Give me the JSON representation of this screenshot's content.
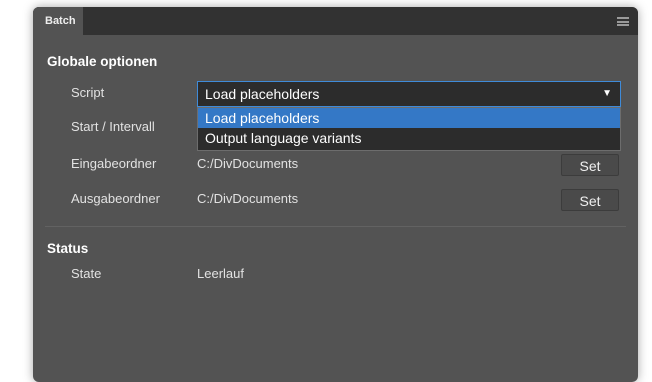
{
  "tab": {
    "title": "Batch"
  },
  "global_section": {
    "title": "Globale optionen",
    "script": {
      "label": "Script",
      "selected": "Load placeholders",
      "options": [
        "Load placeholders",
        "Output language variants"
      ]
    },
    "start_interval": {
      "label": "Start / Intervall"
    },
    "input_folder": {
      "label": "Eingabeordner",
      "value": "C:/DivDocuments",
      "button": "Set"
    },
    "output_folder": {
      "label": "Ausgabeordner",
      "value": "C:/DivDocuments",
      "button": "Set"
    }
  },
  "status_section": {
    "title": "Status",
    "state": {
      "label": "State",
      "value": "Leerlauf"
    }
  },
  "colors": {
    "panel": "#535353",
    "tabbar": "#323232",
    "accent": "#3478c6",
    "focus_border": "#3f8bd9"
  },
  "icons": {
    "panel_menu": "hamburger-menu-icon",
    "dropdown": "triangle-down-icon"
  }
}
